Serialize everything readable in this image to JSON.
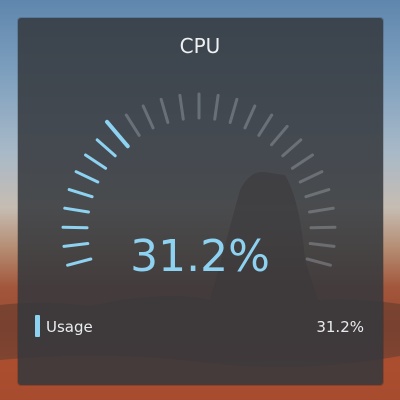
{
  "widget": {
    "title": "CPU",
    "value_text": "31.2%",
    "value_fraction": 0.312,
    "active_color": "#8ed2f2",
    "inactive_color": "#9aa0a6",
    "legend": {
      "label": "Usage",
      "value": "31.2%",
      "color": "#8ed2f2"
    }
  }
}
